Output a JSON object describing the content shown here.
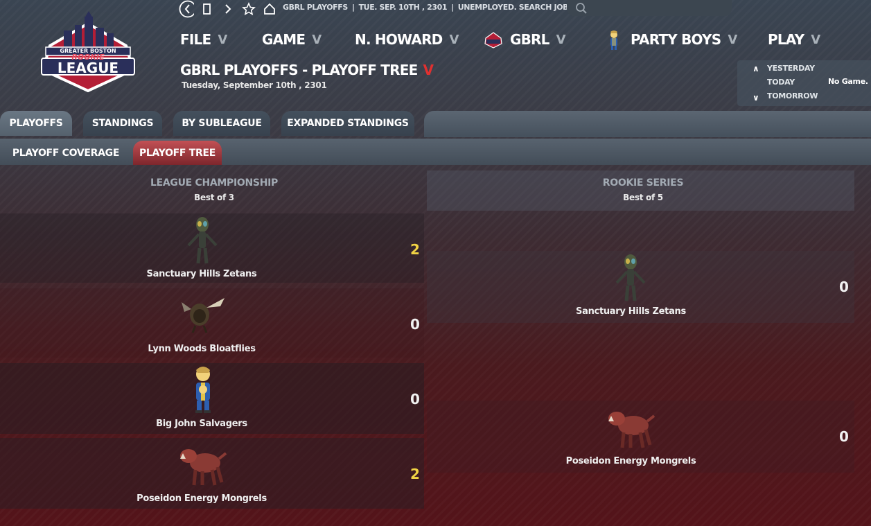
{
  "app": {
    "logo": {
      "line1": "GREATER BOSTON",
      "line2": "ROOKIE",
      "line3": "LEAGUE"
    }
  },
  "topbar": {
    "breadcrumb": [
      "GBRL PLAYOFFS",
      "TUE. SEP. 10TH , 2301",
      "UNEMPLOYED. SEARCH JOBS..."
    ],
    "search_placeholder": ""
  },
  "menu": {
    "file": "FILE",
    "game": "GAME",
    "manager": "N. HOWARD",
    "league": "GBRL",
    "team": "PARTY BOYS",
    "play": "PLAY",
    "chevron": "V"
  },
  "page": {
    "title": "GBRL PLAYOFFS - PLAYOFF TREE",
    "title_chevron": "V",
    "date": "Tuesday, September 10th , 2301"
  },
  "daynav": {
    "yesterday": "YESTERDAY",
    "today": "TODAY",
    "tomorrow": "TOMORROW",
    "status": "No Game."
  },
  "tabs": [
    "PLAYOFFS",
    "STANDINGS",
    "BY SUBLEAGUE",
    "EXPANDED STANDINGS"
  ],
  "subtabs": [
    "PLAYOFF COVERAGE",
    "PLAYOFF TREE"
  ],
  "bracket": {
    "left": {
      "title": "LEAGUE CHAMPIONSHIP",
      "subtitle": "Best of 3",
      "teams": [
        {
          "name": "Sanctuary Hills Zetans",
          "score": "2",
          "icon": "alien-icon"
        },
        {
          "name": "Lynn Woods Bloatflies",
          "score": "0",
          "icon": "bloatfly-icon"
        },
        {
          "name": "Big John Salvagers",
          "score": "0",
          "icon": "vault-boy-icon"
        },
        {
          "name": "Poseidon Energy Mongrels",
          "score": "2",
          "icon": "mongrel-icon"
        }
      ]
    },
    "right": {
      "title": "ROOKIE SERIES",
      "subtitle": "Best of 5",
      "teams": [
        {
          "name": "Sanctuary Hills Zetans",
          "score": "0",
          "icon": "alien-icon"
        },
        {
          "name": "Poseidon Energy Mongrels",
          "score": "0",
          "icon": "mongrel-icon"
        }
      ]
    }
  },
  "colors": {
    "win": "#f1d344",
    "accent": "#e03030",
    "active_subtab": "#b0444a"
  }
}
